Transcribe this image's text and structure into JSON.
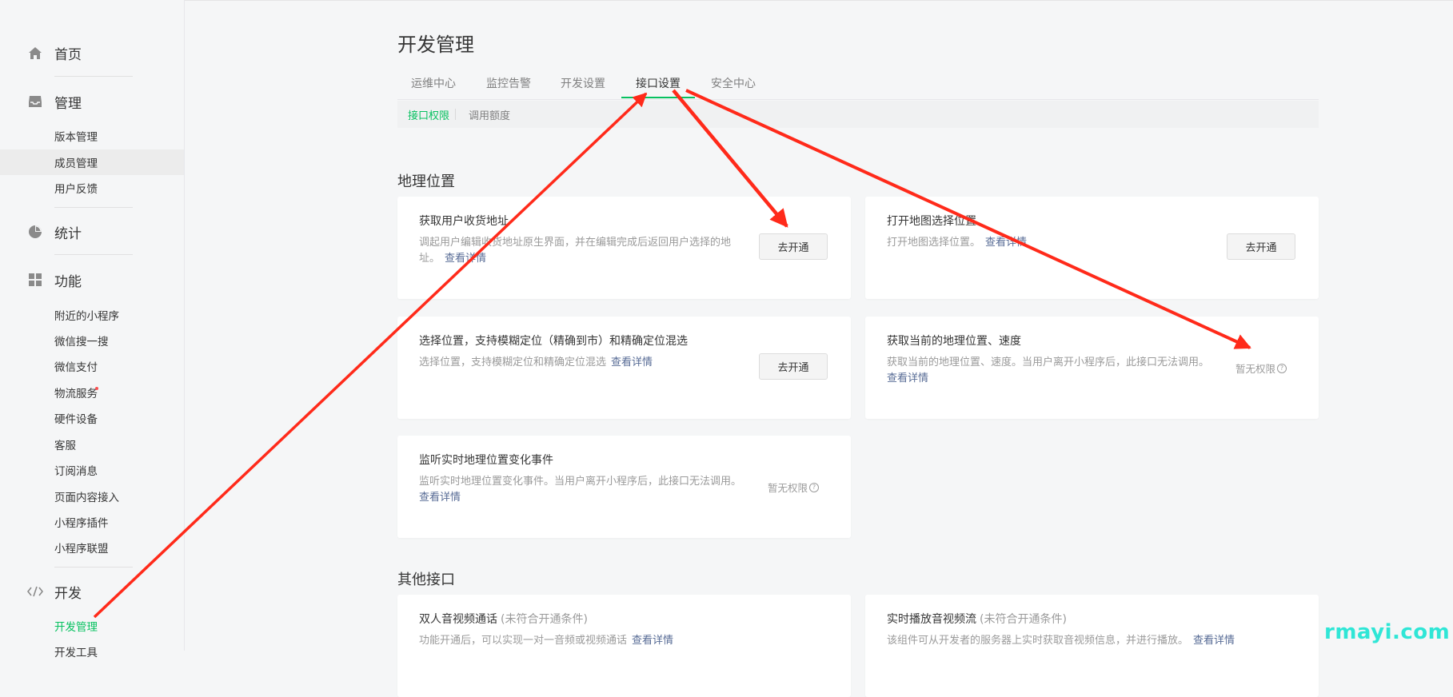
{
  "sidebar": {
    "home": {
      "label": "首页",
      "icon": "home-icon"
    },
    "manage": {
      "label": "管理",
      "icon": "inbox-icon",
      "items": [
        {
          "label": "版本管理"
        },
        {
          "label": "成员管理"
        },
        {
          "label": "用户反馈"
        }
      ]
    },
    "stats": {
      "label": "统计",
      "icon": "pie-chart-icon"
    },
    "features": {
      "label": "功能",
      "icon": "grid-icon",
      "items": [
        {
          "label": "附近的小程序"
        },
        {
          "label": "微信搜一搜"
        },
        {
          "label": "微信支付"
        },
        {
          "label": "物流服务"
        },
        {
          "label": "硬件设备"
        },
        {
          "label": "客服"
        },
        {
          "label": "订阅消息"
        },
        {
          "label": "页面内容接入"
        },
        {
          "label": "小程序插件"
        },
        {
          "label": "小程序联盟"
        }
      ]
    },
    "dev": {
      "label": "开发",
      "icon": "code-icon",
      "items": [
        {
          "label": "开发管理"
        },
        {
          "label": "开发工具"
        }
      ]
    }
  },
  "main": {
    "title": "开发管理",
    "tabs": [
      {
        "label": "运维中心"
      },
      {
        "label": "监控告警"
      },
      {
        "label": "开发设置"
      },
      {
        "label": "接口设置"
      },
      {
        "label": "安全中心"
      }
    ],
    "subtabs": [
      {
        "label": "接口权限"
      },
      {
        "label": "调用额度"
      }
    ],
    "sections": [
      {
        "title": "地理位置",
        "cards": [
          {
            "title": "获取用户收货地址",
            "desc": "调起用户编辑收货地址原生界面，并在编辑完成后返回用户选择的地址。",
            "link": "查看详情",
            "action": "去开通"
          },
          {
            "title": "打开地图选择位置",
            "desc": "打开地图选择位置。",
            "link": "查看详情",
            "action": "去开通"
          },
          {
            "title": "选择位置，支持模糊定位（精确到市）和精确定位混选",
            "desc": "选择位置，支持模糊定位和精确定位混选",
            "link": "查看详情",
            "action": "去开通"
          },
          {
            "title": "获取当前的地理位置、速度",
            "desc": "获取当前的地理位置、速度。当用户离开小程序后，此接口无法调用。",
            "link": "查看详情",
            "status": "暂无权限"
          },
          {
            "title": "监听实时地理位置变化事件",
            "desc": "监听实时地理位置变化事件。当用户离开小程序后，此接口无法调用。",
            "link": "查看详情",
            "status": "暂无权限"
          }
        ]
      },
      {
        "title": "其他接口",
        "cards": [
          {
            "title": "双人音视频通话",
            "condition": "(未符合开通条件)",
            "desc": "功能开通后，可以实现一对一音频或视频通话",
            "link": "查看详情"
          },
          {
            "title": "实时播放音视频流",
            "condition": "(未符合开通条件)",
            "desc": "该组件可从开发者的服务器上实时获取音视频信息，并进行播放。",
            "link": "查看详情"
          }
        ]
      }
    ]
  },
  "watermark": "rmayi.com",
  "colors": {
    "accent": "#07c160",
    "link": "#576b95",
    "annotation": "#ff2a1a"
  }
}
